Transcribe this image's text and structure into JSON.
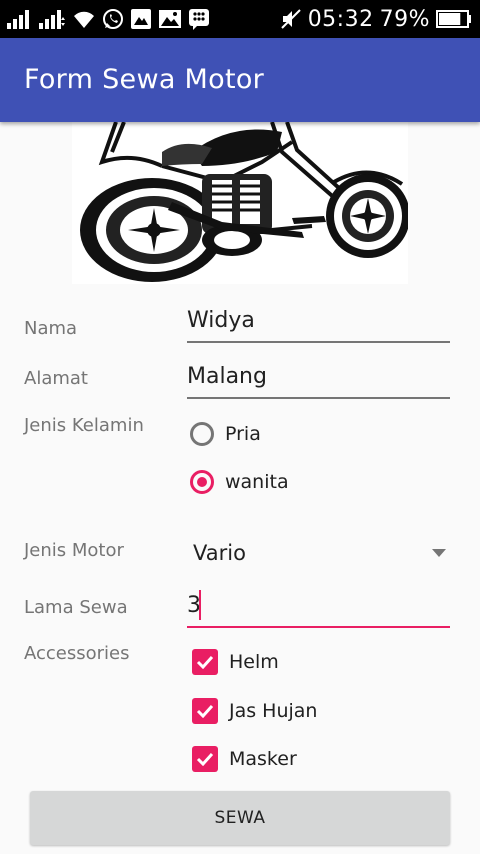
{
  "status_bar": {
    "time": "05:32",
    "battery_percent": "79%",
    "battery_level": 0.79,
    "icons": [
      "signal-icon",
      "signal-data-icon",
      "wifi-icon",
      "whatsapp-icon",
      "gallery-icon",
      "image-icon",
      "bbm-icon",
      "mute-icon",
      "battery-icon"
    ]
  },
  "app_bar": {
    "title": "Form Sewa Motor",
    "color": "#3f51b5"
  },
  "hero_image": {
    "icon": "motorcycle-image"
  },
  "form": {
    "nama": {
      "label": "Nama",
      "value": "Widya"
    },
    "alamat": {
      "label": "Alamat",
      "value": "Malang"
    },
    "jenis_kelamin": {
      "label": "Jenis Kelamin",
      "options": [
        {
          "label": "Pria",
          "checked": false
        },
        {
          "label": "wanita",
          "checked": true
        }
      ]
    },
    "jenis_motor": {
      "label": "Jenis Motor",
      "selected": "Vario"
    },
    "lama_sewa": {
      "label": "Lama Sewa",
      "value": "3"
    },
    "accessories": {
      "label": "Accessories",
      "items": [
        {
          "label": "Helm",
          "checked": true
        },
        {
          "label": "Jas Hujan",
          "checked": true
        },
        {
          "label": "Masker",
          "checked": true
        }
      ]
    },
    "submit_label": "SEWA"
  },
  "colors": {
    "accent": "#e91e63",
    "primary": "#3f51b5",
    "button_bg": "#d6d7d7"
  }
}
